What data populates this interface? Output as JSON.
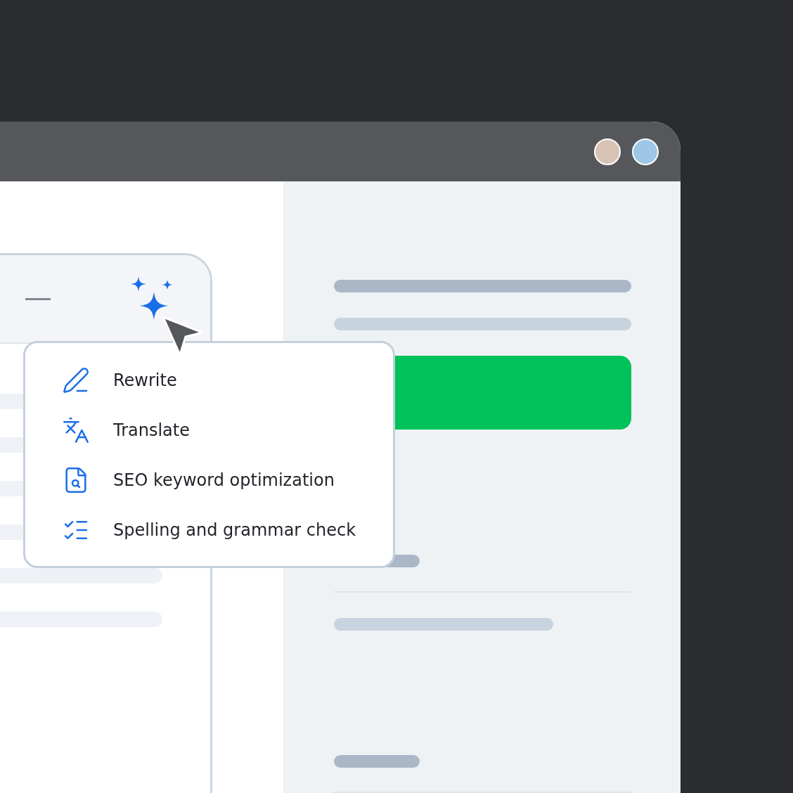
{
  "ai_menu": {
    "items": [
      {
        "kind": "rewrite",
        "label": "Rewrite"
      },
      {
        "kind": "translate",
        "label": "Translate"
      },
      {
        "kind": "seo",
        "label": "SEO keyword optimization"
      },
      {
        "kind": "spelling",
        "label": "Spelling and grammar check"
      }
    ]
  }
}
